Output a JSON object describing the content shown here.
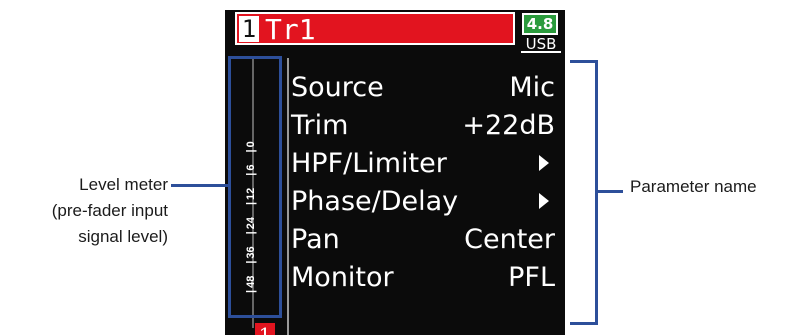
{
  "screen": {
    "track_number": "1",
    "track_name": "Tr1",
    "battery": "4.8",
    "connection": "USB",
    "meter": {
      "ticks": [
        "48",
        "36",
        "24",
        "12",
        "6",
        "0"
      ],
      "clip_badge": "1"
    },
    "params": [
      {
        "name": "Source",
        "value": "Mic",
        "submenu": false
      },
      {
        "name": "Trim",
        "value": "+22dB",
        "submenu": false
      },
      {
        "name": "HPF/Limiter",
        "value": "",
        "submenu": true
      },
      {
        "name": "Phase/Delay",
        "value": "",
        "submenu": true
      },
      {
        "name": "Pan",
        "value": "Center",
        "submenu": false
      },
      {
        "name": "Monitor",
        "value": "PFL",
        "submenu": false
      }
    ]
  },
  "annotations": {
    "left_line1": "Level meter",
    "left_line2": "(pre-fader input",
    "left_line3": "signal level)",
    "right": "Parameter name"
  },
  "colors": {
    "title_red": "#e2141f",
    "battery_green": "#2a9b3c",
    "annotation_blue": "#2d4f9a",
    "screen_bg": "#0b0b0b"
  }
}
